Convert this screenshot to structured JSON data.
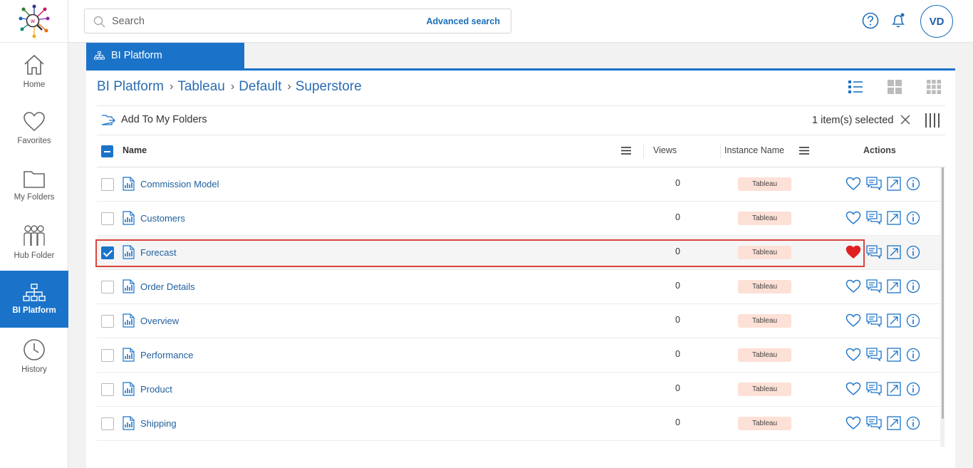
{
  "sidebar": {
    "items": [
      {
        "label": "Home",
        "icon": "home-icon"
      },
      {
        "label": "Favorites",
        "icon": "heart-icon"
      },
      {
        "label": "My Folders",
        "icon": "folder-icon"
      },
      {
        "label": "Hub Folder",
        "icon": "people-icon"
      },
      {
        "label": "BI Platform",
        "icon": "hierarchy-icon",
        "active": true
      },
      {
        "label": "History",
        "icon": "clock-icon"
      }
    ]
  },
  "search": {
    "placeholder": "Search",
    "value": "",
    "advanced_label": "Advanced search"
  },
  "user": {
    "initials": "VD"
  },
  "tab": {
    "label": "BI Platform"
  },
  "breadcrumb": [
    {
      "label": "BI Platform"
    },
    {
      "label": "Tableau"
    },
    {
      "label": "Default"
    },
    {
      "label": "Superstore"
    }
  ],
  "toolbar": {
    "add_to_folders": "Add To My Folders",
    "selection": "1 item(s) selected"
  },
  "table": {
    "columns": {
      "name": "Name",
      "views": "Views",
      "instance": "Instance Name",
      "actions": "Actions"
    },
    "rows": [
      {
        "name": "Commission Model",
        "views": "0",
        "instance": "Tableau",
        "checked": false,
        "favorite": false
      },
      {
        "name": "Customers",
        "views": "0",
        "instance": "Tableau",
        "checked": false,
        "favorite": false
      },
      {
        "name": "Forecast",
        "views": "0",
        "instance": "Tableau",
        "checked": true,
        "favorite": true
      },
      {
        "name": "Order Details",
        "views": "0",
        "instance": "Tableau",
        "checked": false,
        "favorite": false
      },
      {
        "name": "Overview",
        "views": "0",
        "instance": "Tableau",
        "checked": false,
        "favorite": false
      },
      {
        "name": "Performance",
        "views": "0",
        "instance": "Tableau",
        "checked": false,
        "favorite": false
      },
      {
        "name": "Product",
        "views": "0",
        "instance": "Tableau",
        "checked": false,
        "favorite": false
      },
      {
        "name": "Shipping",
        "views": "0",
        "instance": "Tableau",
        "checked": false,
        "favorite": false
      }
    ]
  },
  "colors": {
    "accent": "#1a73c9",
    "favorite": "#e02020",
    "badge": "#fde0d6",
    "highlight": "#d9453d"
  }
}
